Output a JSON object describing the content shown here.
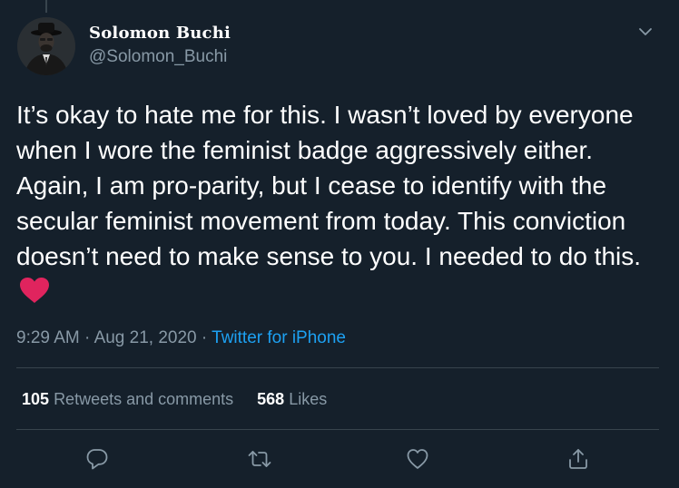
{
  "author": {
    "name": "Solomon Buchi",
    "handle": "@Solomon_Buchi"
  },
  "tweet": {
    "text": "It’s okay to hate me for this. I wasn’t loved by everyone when I wore the feminist badge aggressively either. Again, I am pro-parity, but I cease to identify with the secular feminist movement from today. This conviction doesn’t need to make sense to you. I needed to do this.",
    "emoji": "red-heart-emoji"
  },
  "meta": {
    "time": "9:29 AM",
    "separator": " · ",
    "date": "Aug 21, 2020",
    "source": "Twitter for iPhone"
  },
  "stats": {
    "retweets_count": "105",
    "retweets_label": "Retweets and comments",
    "likes_count": "568",
    "likes_label": "Likes"
  },
  "icons": {
    "reply": "reply-icon",
    "retweet": "retweet-icon",
    "like": "like-icon",
    "share": "share-icon",
    "more": "chevron-down-icon"
  },
  "colors": {
    "background": "#15202b",
    "secondary_text": "#8899a6",
    "link": "#1da1f2",
    "divider": "#38444d",
    "heart": "#e0245e"
  }
}
